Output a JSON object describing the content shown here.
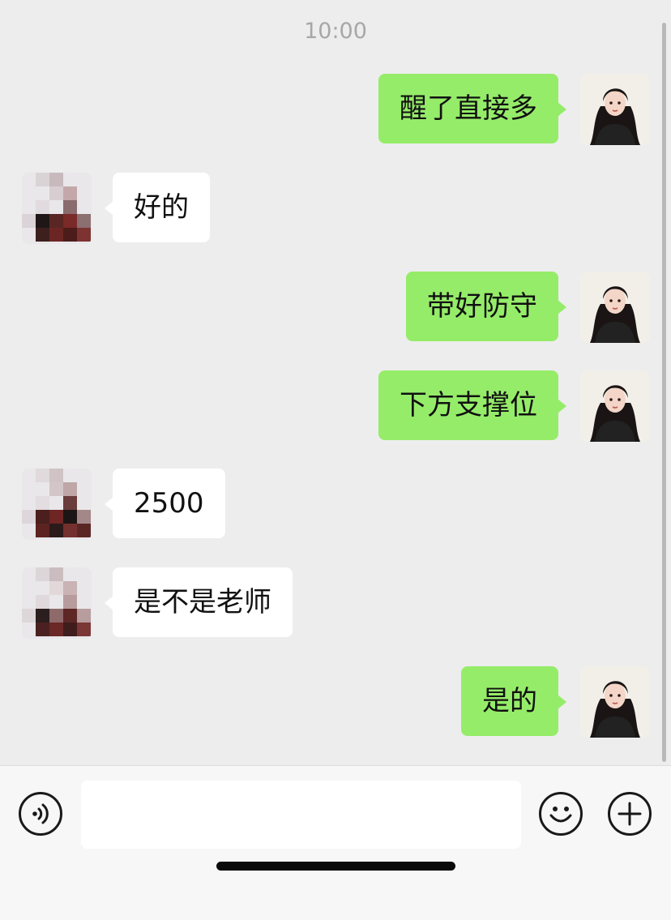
{
  "chat": {
    "timestamp": "10:00",
    "messages": [
      {
        "side": "right",
        "text": "醒了直接多"
      },
      {
        "side": "left",
        "text": "好的"
      },
      {
        "side": "right",
        "text": "带好防守"
      },
      {
        "side": "right",
        "text": "下方支撑位"
      },
      {
        "side": "left",
        "text": "2500"
      },
      {
        "side": "left",
        "text": "是不是老师"
      },
      {
        "side": "right",
        "text": "是的"
      }
    ]
  },
  "colors": {
    "background": "#ededed",
    "sent_bubble": "#95ec69",
    "received_bubble": "#ffffff",
    "input_bar": "#f7f7f7"
  },
  "input_bar": {
    "voice_icon": "voice-icon",
    "emoji_icon": "emoji-icon",
    "plus_icon": "plus-icon",
    "text_value": ""
  }
}
